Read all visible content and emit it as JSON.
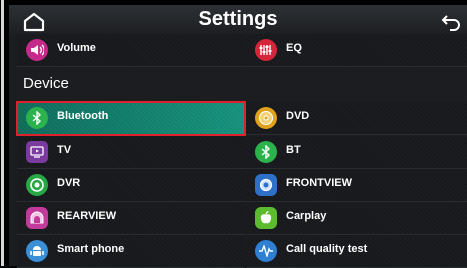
{
  "header": {
    "title": "Settings"
  },
  "sections": {
    "device": "Device"
  },
  "items": {
    "volume": "Volume",
    "eq": "EQ",
    "bluetooth": "Bluetooth",
    "dvd": "DVD",
    "tv": "TV",
    "bt": "BT",
    "dvr": "DVR",
    "frontview": "FRONTVIEW",
    "rearview": "REARVIEW",
    "carplay": "Carplay",
    "smart_phone": "Smart phone",
    "call_quality_test": "Call quality test"
  },
  "selected": "bluetooth",
  "colors": {
    "selected_bg": "#14907a",
    "selected_border": "#e0202a",
    "accent_red": "#d6243a"
  }
}
